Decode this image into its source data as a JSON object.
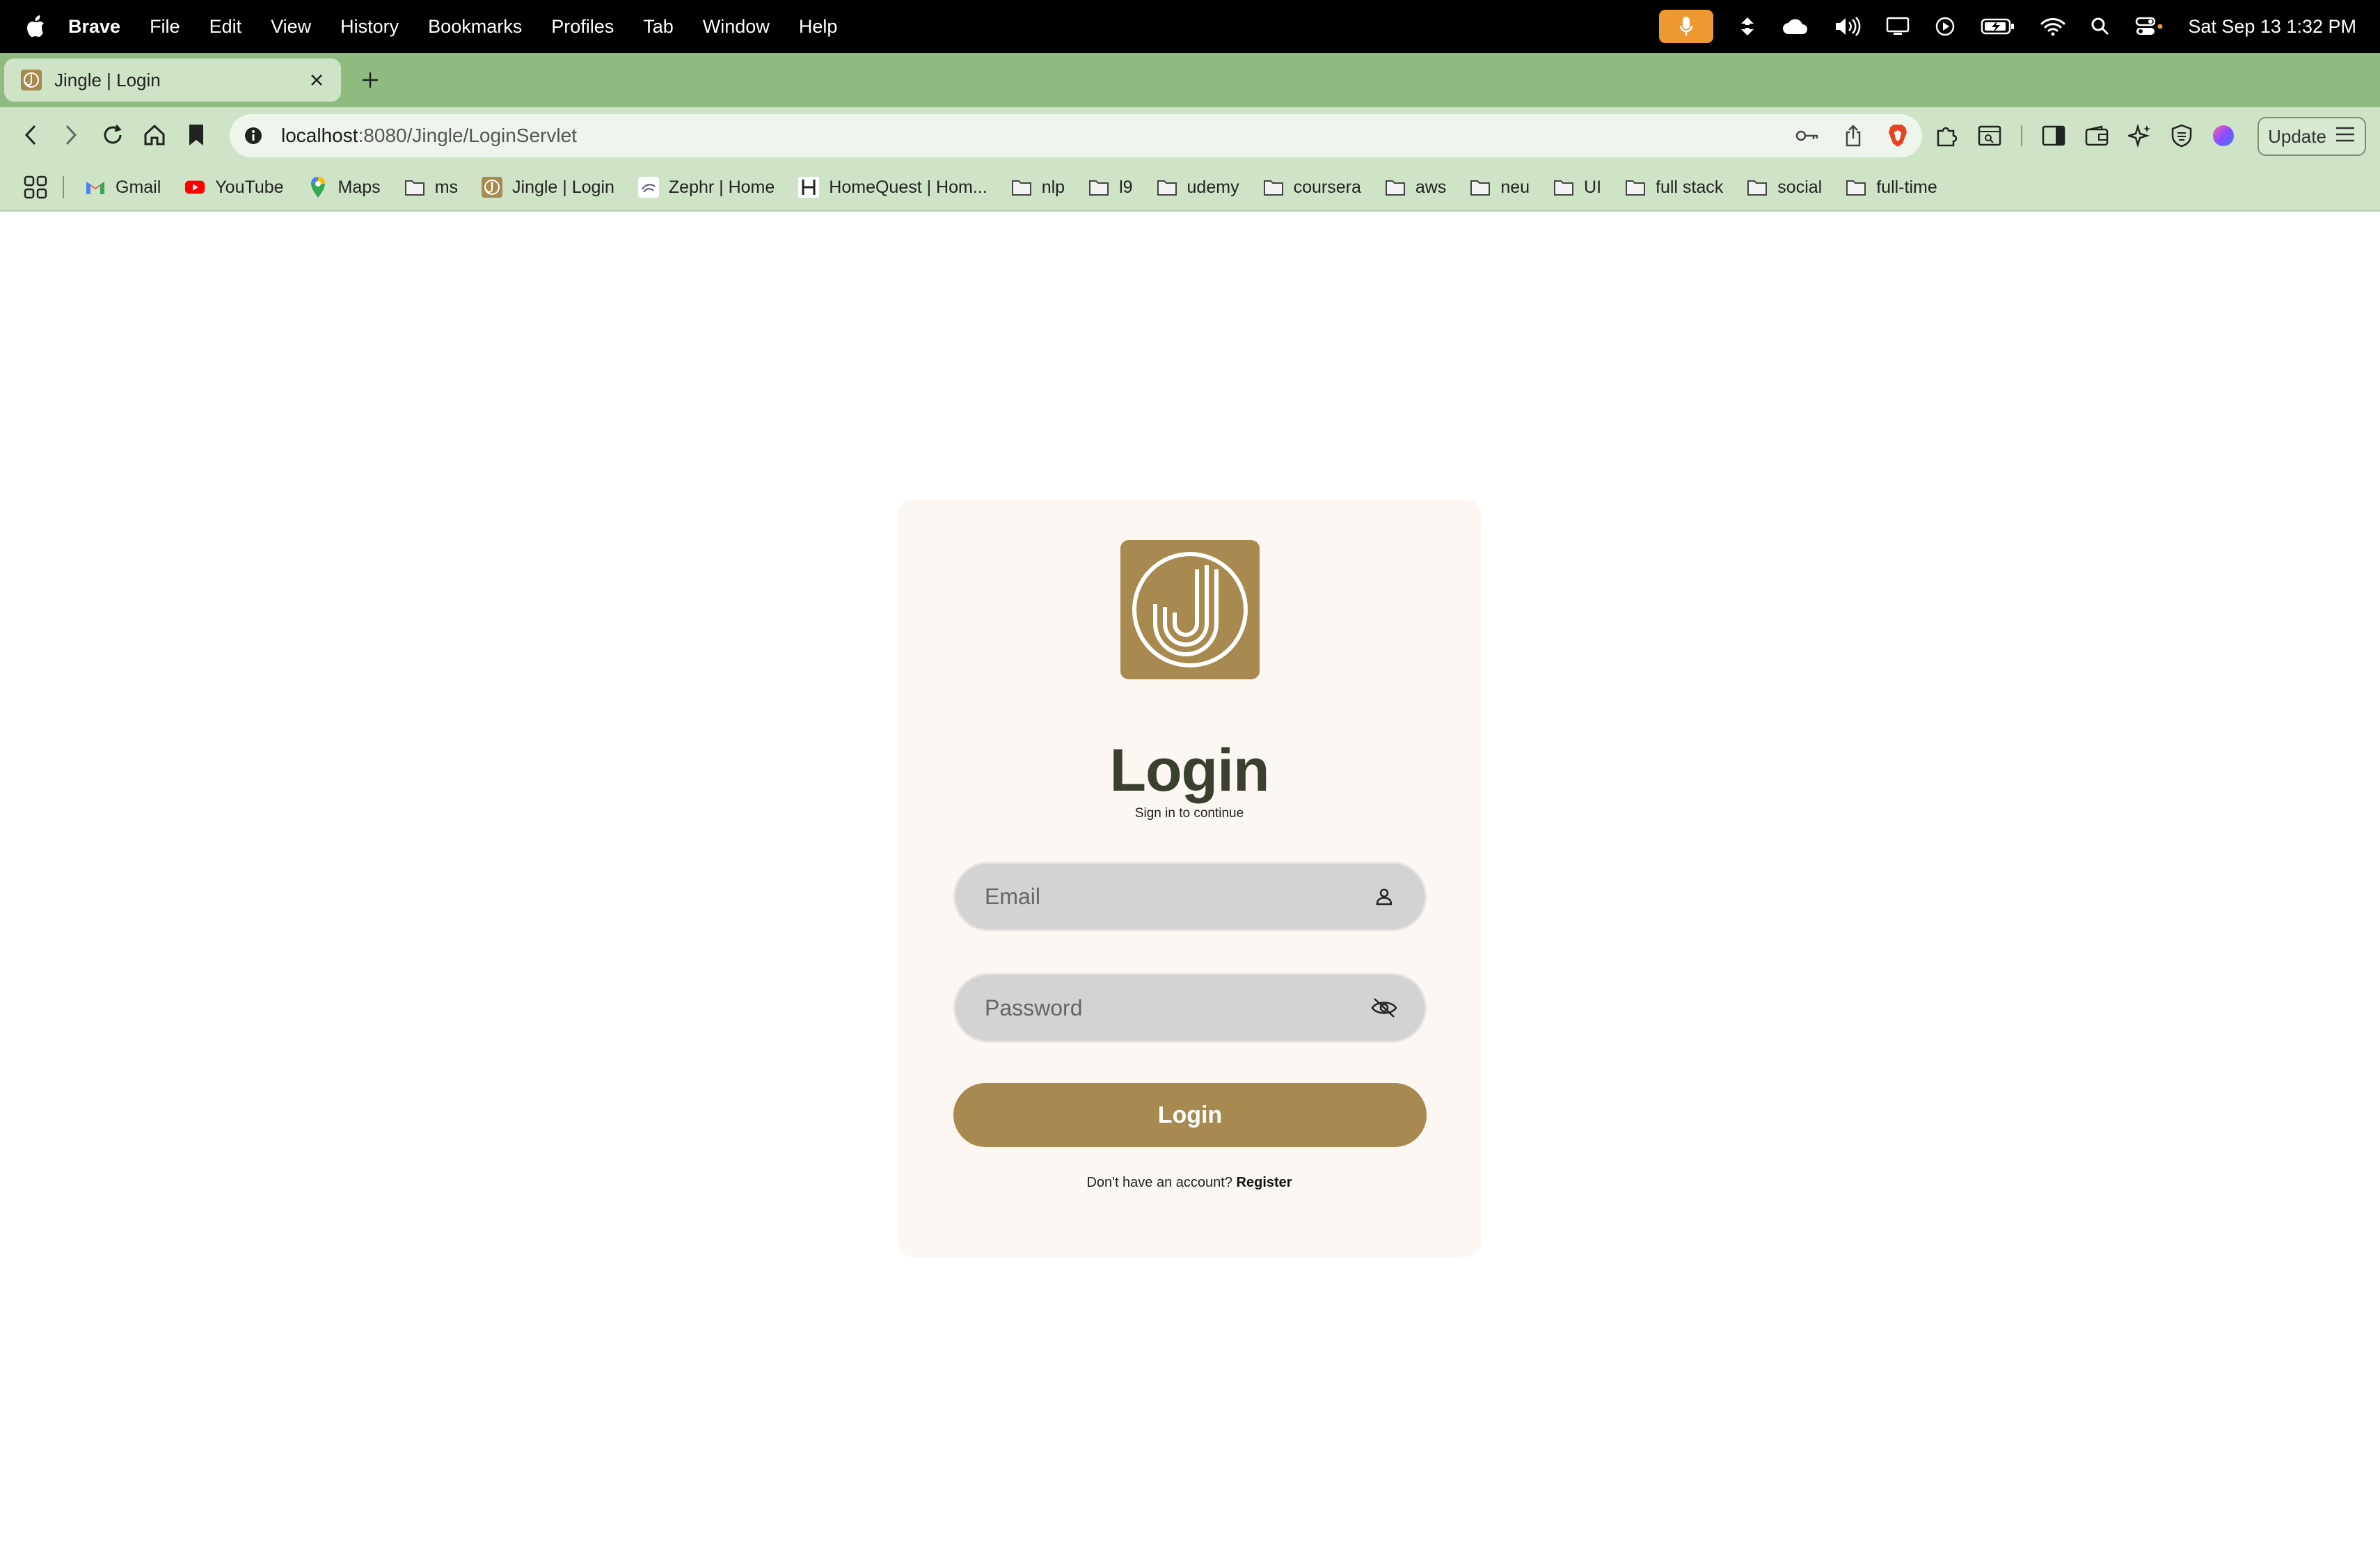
{
  "menubar": {
    "app_name": "Brave",
    "menus": [
      "File",
      "Edit",
      "View",
      "History",
      "Bookmarks",
      "Profiles",
      "Tab",
      "Window",
      "Help"
    ],
    "clock": "Sat Sep 13  1:32 PM",
    "icons": [
      "apple-icon",
      "microphone-icon",
      "sync-icon",
      "cloud-icon",
      "volume-icon",
      "display-icon",
      "play-icon",
      "battery-icon",
      "wifi-icon",
      "search-icon",
      "control-center-icon"
    ]
  },
  "browser": {
    "tab_title": "Jingle | Login",
    "url_host": "localhost",
    "url_path": ":8080/Jingle/LoginServlet",
    "update_label": "Update",
    "bookmarks": [
      {
        "label": "Gmail",
        "icon": "gmail-icon"
      },
      {
        "label": "YouTube",
        "icon": "youtube-icon"
      },
      {
        "label": "Maps",
        "icon": "maps-icon"
      },
      {
        "label": "ms",
        "icon": "folder-icon"
      },
      {
        "label": "Jingle | Login",
        "icon": "jingle-icon"
      },
      {
        "label": "Zephr | Home",
        "icon": "zephr-icon"
      },
      {
        "label": "HomeQuest | Hom...",
        "icon": "homequest-icon"
      },
      {
        "label": "nlp",
        "icon": "folder-icon"
      },
      {
        "label": "l9",
        "icon": "folder-icon"
      },
      {
        "label": "udemy",
        "icon": "folder-icon"
      },
      {
        "label": "coursera",
        "icon": "folder-icon"
      },
      {
        "label": "aws",
        "icon": "folder-icon"
      },
      {
        "label": "neu",
        "icon": "folder-icon"
      },
      {
        "label": "UI",
        "icon": "folder-icon"
      },
      {
        "label": "full stack",
        "icon": "folder-icon"
      },
      {
        "label": "social",
        "icon": "folder-icon"
      },
      {
        "label": "full-time",
        "icon": "folder-icon"
      }
    ]
  },
  "login": {
    "title": "Login",
    "subtitle": "Sign in to continue",
    "email_placeholder": "Email",
    "password_placeholder": "Password",
    "submit_label": "Login",
    "register_prompt": "Don't have an account?",
    "register_link": "Register"
  },
  "colors": {
    "accent": "#a8894f",
    "title": "#3a3f2e",
    "card_bg": "#fdf7f3",
    "field_bg": "#d3d3d3",
    "tabstrip": "#8fbb80",
    "toolbar": "#cfe3c7"
  }
}
